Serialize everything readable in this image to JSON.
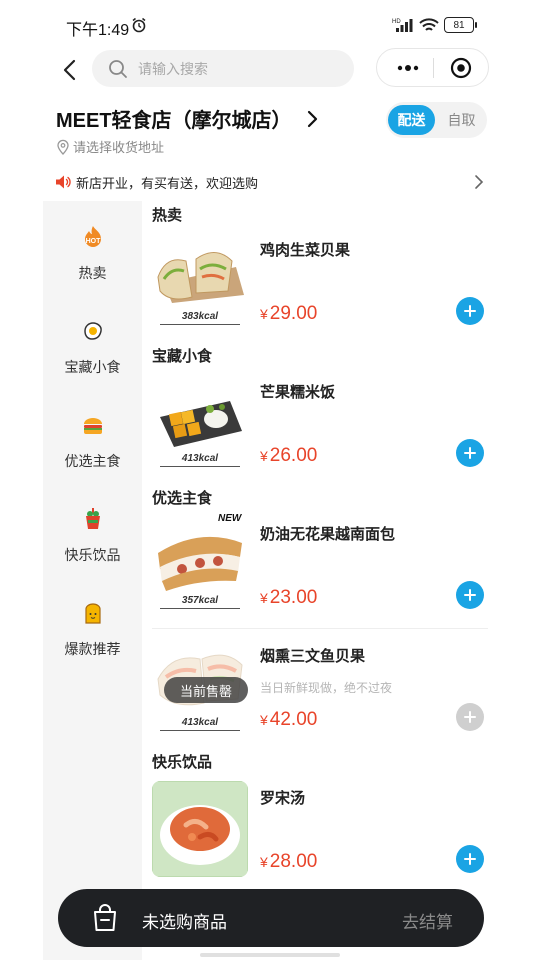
{
  "status_bar": {
    "time": "下午1:49",
    "battery": "81"
  },
  "search": {
    "placeholder": "请输入搜索"
  },
  "store": {
    "name": "MEET轻食店（摩尔城店）",
    "address_prompt": "请选择收货地址"
  },
  "delivery_modes": {
    "active": "配送",
    "inactive": "自取"
  },
  "notice": {
    "text": "新店开业，有买有送，欢迎选购"
  },
  "categories": [
    {
      "label": "热卖",
      "icon": "hot-badge-icon"
    },
    {
      "label": "宝藏小食",
      "icon": "fried-egg-icon"
    },
    {
      "label": "优选主食",
      "icon": "burger-icon"
    },
    {
      "label": "快乐饮品",
      "icon": "drink-cup-icon"
    },
    {
      "label": "爆款推荐",
      "icon": "toast-bread-icon"
    }
  ],
  "sections": [
    {
      "title": "热卖"
    },
    {
      "title": "宝藏小食"
    },
    {
      "title": "优选主食"
    },
    {
      "title": "快乐饮品"
    }
  ],
  "products": [
    {
      "name": "鸡肉生菜贝果",
      "price": "29.00",
      "kcal": "383kcal",
      "currency": "¥"
    },
    {
      "name": "芒果糯米饭",
      "price": "26.00",
      "kcal": "413kcal",
      "currency": "¥"
    },
    {
      "name": "奶油无花果越南面包",
      "price": "23.00",
      "kcal": "357kcal",
      "badge": "NEW",
      "currency": "¥"
    },
    {
      "name": "烟熏三文鱼贝果",
      "price": "42.00",
      "kcal": "413kcal",
      "description": "当日新鲜现做，绝不过夜",
      "soldout": "当前售罄",
      "currency": "¥"
    },
    {
      "name": "罗宋汤",
      "price": "28.00",
      "currency": "¥"
    }
  ],
  "cart": {
    "empty_text": "未选购商品",
    "checkout_label": "去结算"
  },
  "colors": {
    "accent": "#1aa4e4",
    "price": "#e8442a",
    "cart_bar": "#1f2124",
    "disabled": "#cfcfcf"
  }
}
